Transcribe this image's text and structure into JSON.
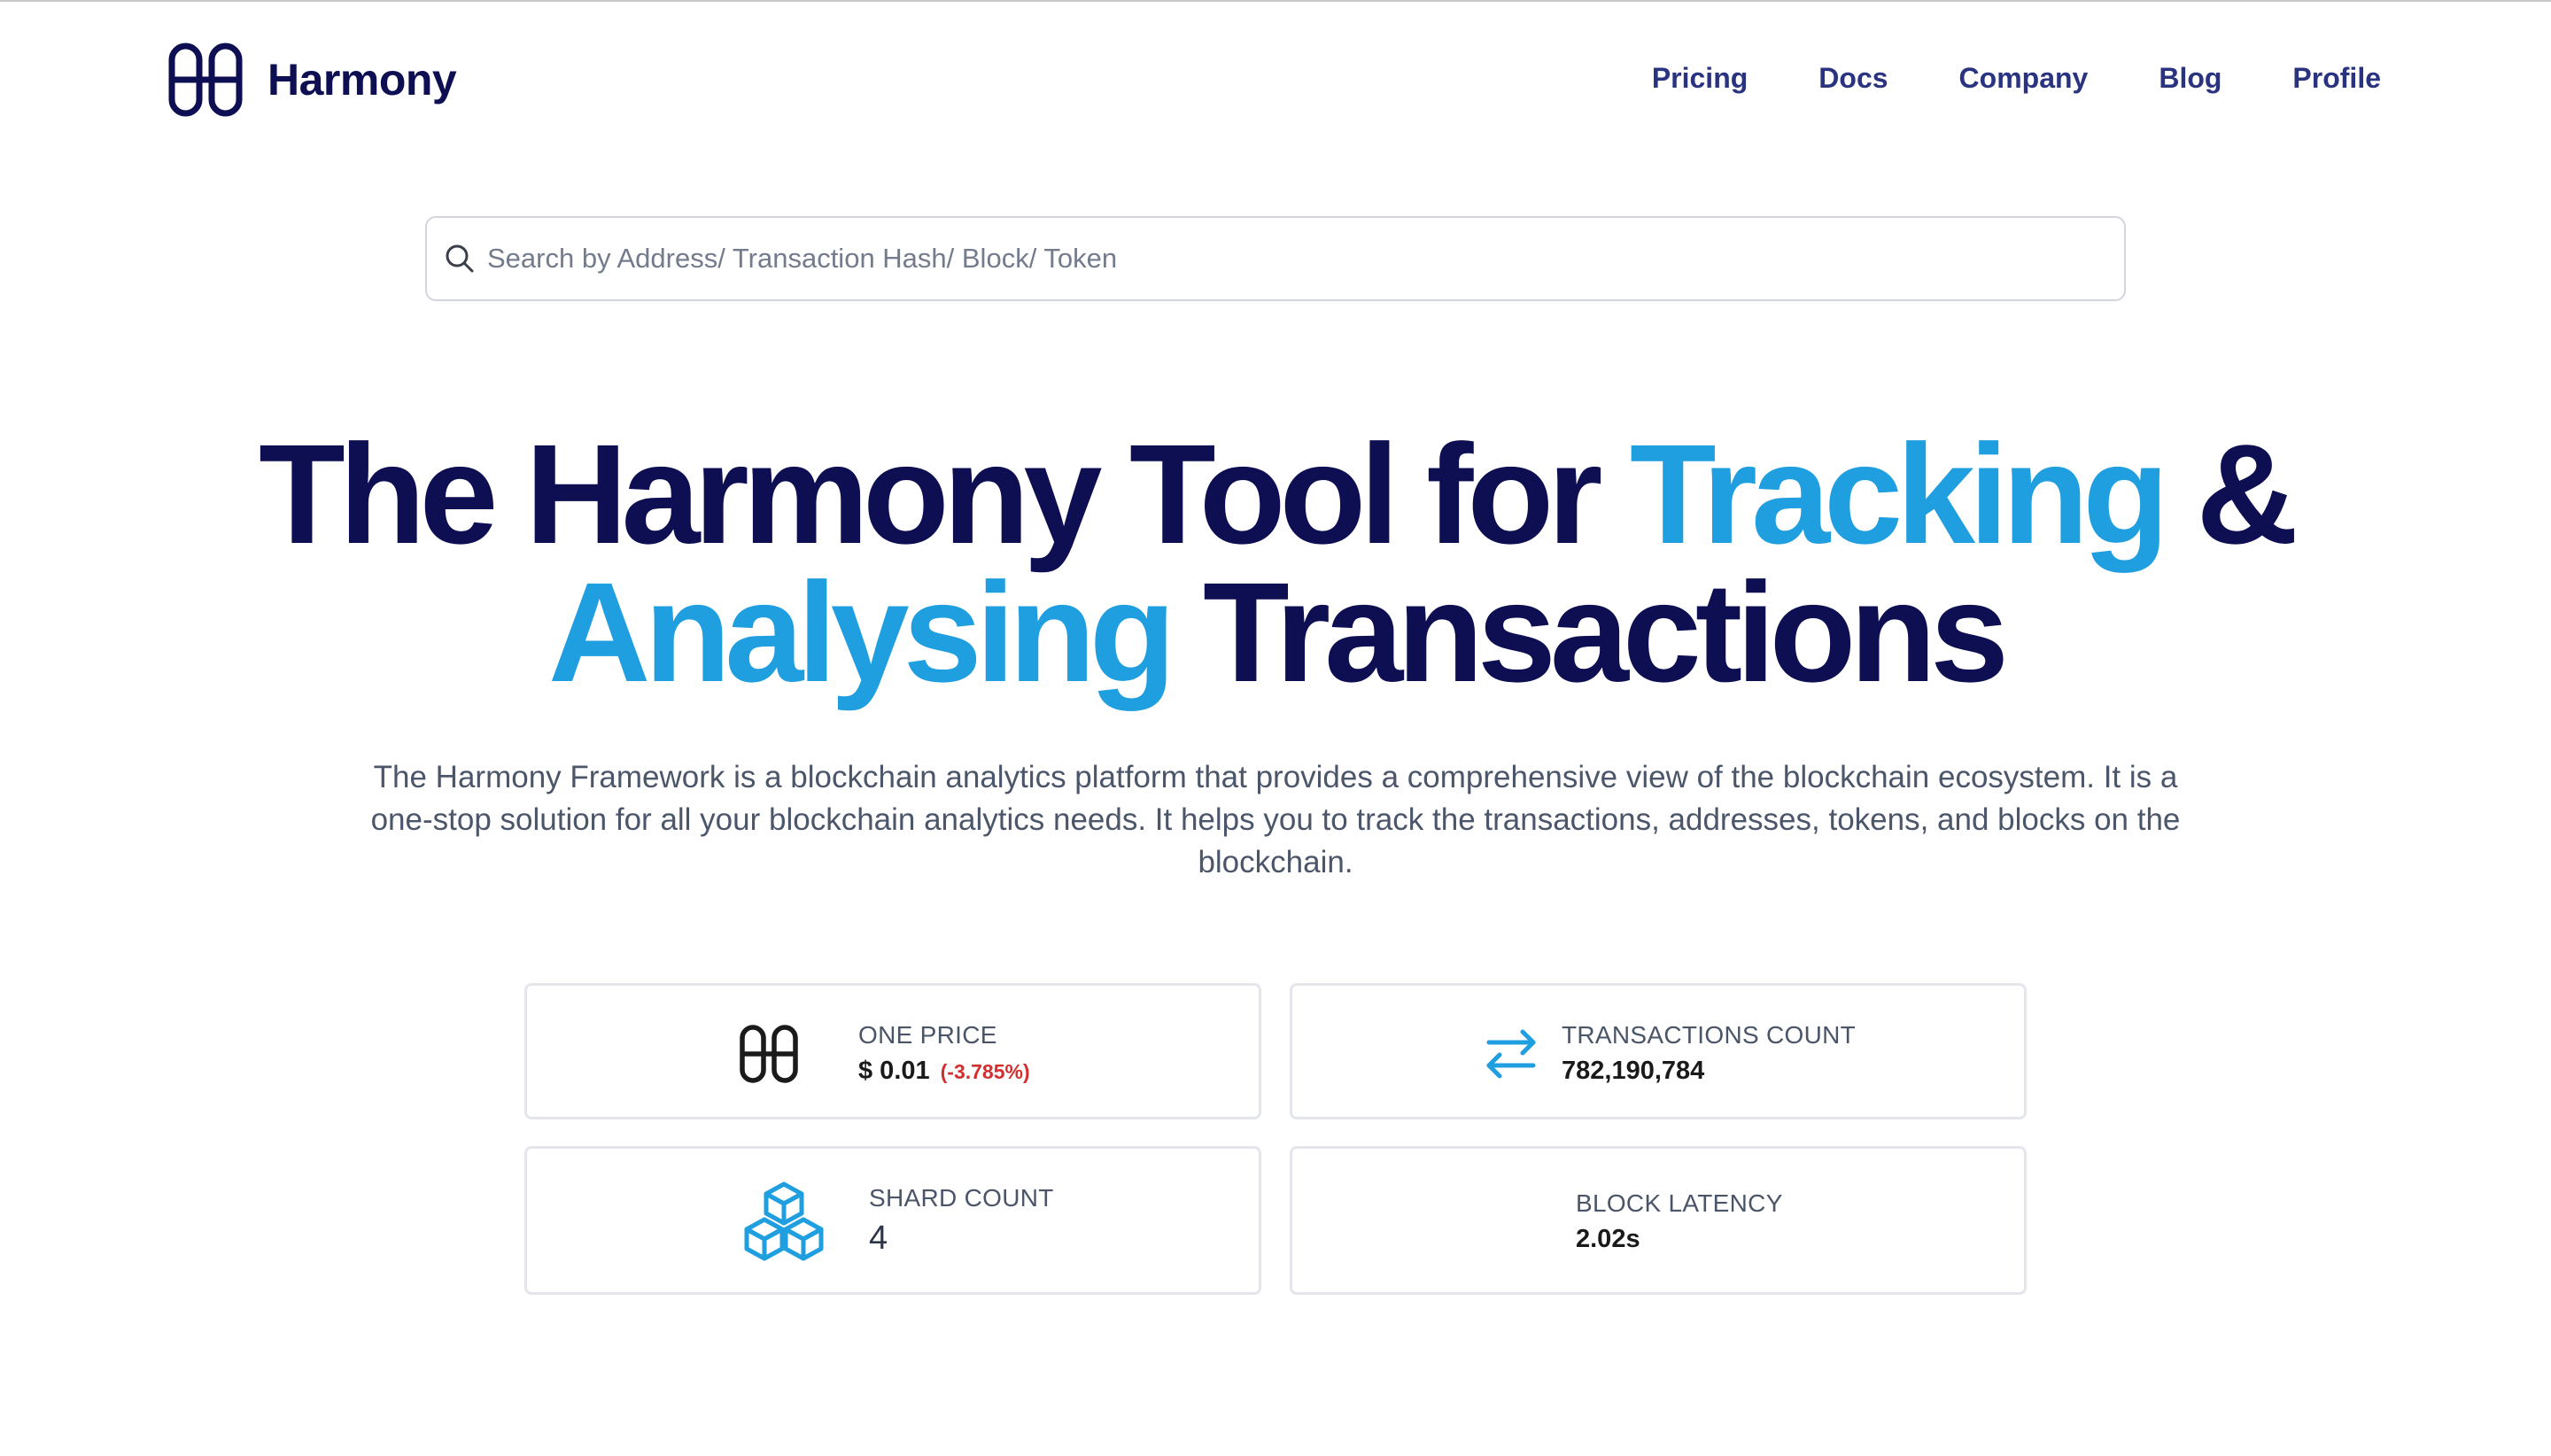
{
  "header": {
    "brand": "Harmony",
    "nav": [
      "Pricing",
      "Docs",
      "Company",
      "Blog",
      "Profile"
    ]
  },
  "search": {
    "placeholder": "Search by Address/ Transaction Hash/ Block/ Token"
  },
  "hero": {
    "title_part1": "The Harmony Tool for ",
    "title_accent1": "Tracking",
    "title_part2": " &",
    "title_accent2": "Analysing",
    "title_part3": " Transactions",
    "description": "The Harmony Framework is a blockchain analytics platform that provides a comprehensive view of the blockchain ecosystem. It is a one-stop solution for all your blockchain analytics needs. It helps you to track the transactions, addresses, tokens, and blocks on the blockchain."
  },
  "stats": {
    "one_price": {
      "label": "ONE PRICE",
      "value": "$ 0.01",
      "change": "(-3.785%)",
      "icon": "harmony-logo-icon"
    },
    "transactions": {
      "label": "TRANSACTIONS COUNT",
      "value": "782,190,784",
      "icon": "swap-arrows-icon"
    },
    "shards": {
      "label": "SHARD COUNT",
      "value": "4",
      "icon": "cubes-icon"
    },
    "latency": {
      "label": "BLOCK LATENCY",
      "value": "2.02s"
    }
  },
  "colors": {
    "navy": "#0e0e52",
    "accent": "#1f9ee0",
    "nav_link": "#2a3380",
    "negative": "#d32f2f"
  }
}
